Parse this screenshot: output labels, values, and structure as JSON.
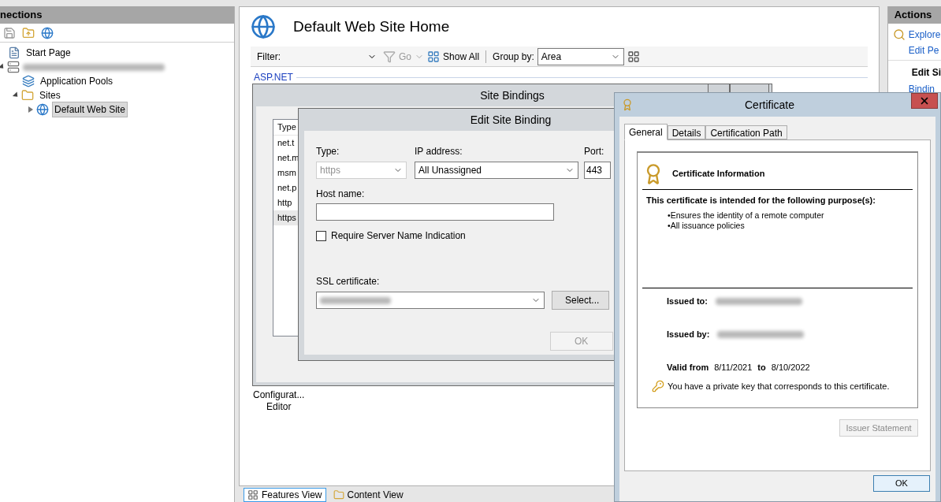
{
  "connections": {
    "title": "nections",
    "tree": [
      {
        "kind": "page",
        "label": "Start Page",
        "selected": false
      },
      {
        "kind": "server",
        "expanded": true,
        "children": [
          {
            "kind": "pools",
            "label": "Application Pools",
            "selected": false
          },
          {
            "kind": "folder",
            "label": "Sites",
            "expanded": true,
            "selected": false,
            "children": [
              {
                "kind": "site",
                "label": "Default Web Site",
                "expanded": false,
                "selected": true
              }
            ]
          }
        ]
      }
    ]
  },
  "page": {
    "title": "Default Web Site Home",
    "filter_label": "Filter:",
    "go": {
      "label": "Go",
      "disabled": true
    },
    "show_all": "Show All",
    "group_by_label": "Group by:",
    "group_by": "Area",
    "group_header": "ASP.NET",
    "feature_lines": [
      "Configurat...",
      "Editor"
    ],
    "view_tabs": [
      {
        "label": "Features View",
        "selected": true
      },
      {
        "label": "Content View",
        "selected": false
      }
    ]
  },
  "actions": {
    "title": "Actions",
    "items": [
      {
        "kind": "link",
        "label": "Explore"
      },
      {
        "kind": "link",
        "label": "Edit Pe"
      },
      {
        "kind": "heading",
        "label": "Edit Si"
      },
      {
        "kind": "link",
        "label": "Bindin"
      }
    ]
  },
  "site_bindings": {
    "title": "Site Bindings",
    "column": "Type",
    "rows": [
      {
        "type": "net.t",
        "selected": false
      },
      {
        "type": "net.m",
        "selected": false
      },
      {
        "type": "msm",
        "selected": false
      },
      {
        "type": "net.p",
        "selected": false
      },
      {
        "type": "http",
        "selected": false
      },
      {
        "type": "https",
        "selected": true
      }
    ]
  },
  "edit_binding": {
    "title": "Edit Site Binding",
    "type_label": "Type:",
    "type_value": "https",
    "type_disabled": true,
    "ip_label": "IP address:",
    "ip_value": "All Unassigned",
    "port_label": "Port:",
    "port_value": "443",
    "host_label": "Host name:",
    "sni_label": "Require Server Name Indication",
    "sni_checked": false,
    "ssl_label": "SSL certificate:",
    "select_button": "Select...",
    "ok_button": {
      "label": "OK",
      "disabled": true
    }
  },
  "certificate": {
    "title": "Certificate",
    "tabs": [
      {
        "label": "General",
        "selected": true
      },
      {
        "label": "Details",
        "selected": false
      },
      {
        "label": "Certification Path",
        "selected": false
      }
    ],
    "info_title": "Certificate Information",
    "purpose_heading": "This certificate is intended for the following purpose(s):",
    "purposes": [
      "•Ensures the identity of a remote computer",
      "•All issuance policies"
    ],
    "issued_to_label": "Issued to:",
    "issued_by_label": "Issued by:",
    "valid_from_label": "Valid from",
    "valid_from": "8/11/2021",
    "to_label": "to",
    "valid_to": "8/10/2022",
    "private_key_note": "You have a private key that corresponds to this certificate.",
    "issuer_statement": {
      "label": "Issuer Statement",
      "disabled": true
    },
    "ok_button": "OK"
  }
}
